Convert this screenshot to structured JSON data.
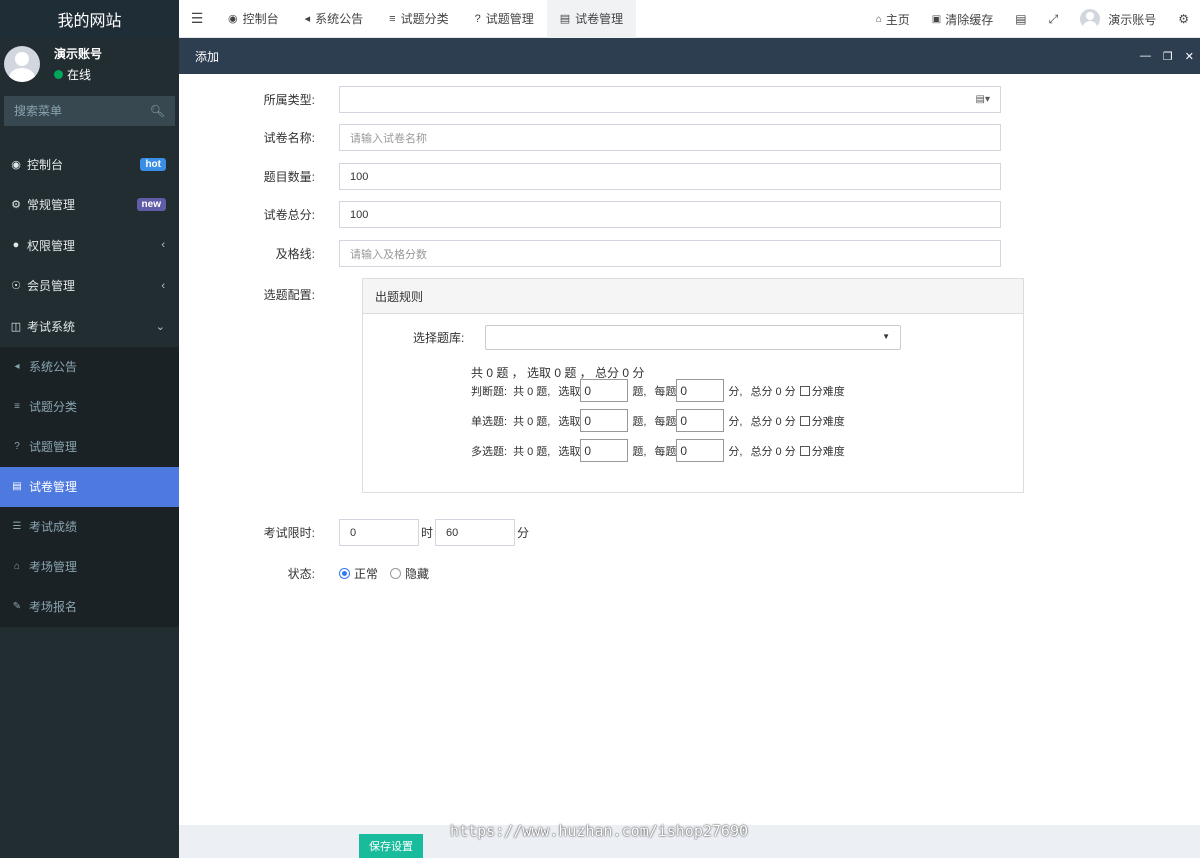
{
  "sidebar": {
    "brand": "我的网站",
    "user": {
      "name": "演示账号",
      "status": "在线"
    },
    "search_placeholder": "搜索菜单",
    "items": [
      {
        "label": "控制台",
        "badge": "hot"
      },
      {
        "label": "常规管理",
        "badge": "new"
      },
      {
        "label": "权限管理"
      },
      {
        "label": "会员管理"
      },
      {
        "label": "考试系统"
      }
    ],
    "subitems": [
      {
        "label": "系统公告"
      },
      {
        "label": "试题分类"
      },
      {
        "label": "试题管理"
      },
      {
        "label": "试卷管理"
      },
      {
        "label": "考试成绩"
      },
      {
        "label": "考场管理"
      },
      {
        "label": "考场报名"
      }
    ]
  },
  "topbar": {
    "tabs": [
      {
        "label": "控制台"
      },
      {
        "label": "系统公告"
      },
      {
        "label": "试题分类"
      },
      {
        "label": "试题管理"
      },
      {
        "label": "试卷管理"
      }
    ],
    "home": "主页",
    "clear_cache": "清除缓存",
    "user": "演示账号"
  },
  "dialog": {
    "title": "添加"
  },
  "form": {
    "type_label": "所属类型:",
    "name_label": "试卷名称:",
    "name_placeholder": "请输入试卷名称",
    "count_label": "题目数量:",
    "count_value": "100",
    "total_label": "试卷总分:",
    "total_value": "100",
    "pass_label": "及格线:",
    "pass_placeholder": "请输入及格分数",
    "config_label": "选题配置:",
    "panel_title": "出题规则",
    "bank_label": "选择题库:",
    "summary": "共 0 题 ， 选取 0 题 ， 总分 0 分",
    "rows": [
      {
        "type": "判断题:",
        "total": "共 0 题,",
        "pick": "选取",
        "pick_value": "0",
        "unit1": "题,",
        "each": "每题",
        "each_value": "0",
        "unit2": "分,",
        "sum": "总分 0 分",
        "difficulty": "分难度"
      },
      {
        "type": "单选题:",
        "total": "共 0 题,",
        "pick": "选取",
        "pick_value": "0",
        "unit1": "题,",
        "each": "每题",
        "each_value": "0",
        "unit2": "分,",
        "sum": "总分 0 分",
        "difficulty": "分难度"
      },
      {
        "type": "多选题:",
        "total": "共 0 题,",
        "pick": "选取",
        "pick_value": "0",
        "unit1": "题,",
        "each": "每题",
        "each_value": "0",
        "unit2": "分,",
        "sum": "总分 0 分",
        "difficulty": "分难度"
      }
    ],
    "time_label": "考试限时:",
    "hours_value": "0",
    "hours_unit": "时",
    "minutes_value": "60",
    "minutes_unit": "分",
    "status_label": "状态:",
    "status_options": [
      {
        "label": "正常",
        "checked": true
      },
      {
        "label": "隐藏",
        "checked": false
      }
    ],
    "save_label": "保存设置"
  },
  "watermark": "https://www.huzhan.com/ishop27690"
}
